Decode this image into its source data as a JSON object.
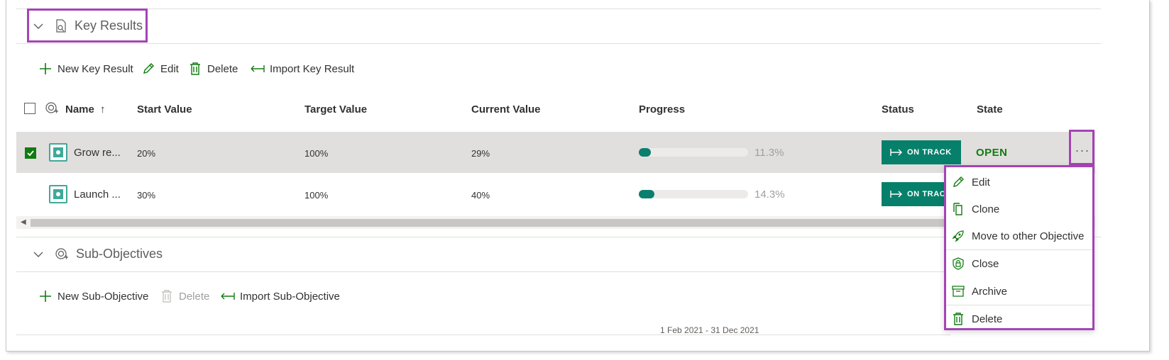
{
  "key_results_section": {
    "title": "Key Results",
    "toolbar": {
      "new_label": "New Key Result",
      "edit_label": "Edit",
      "delete_label": "Delete",
      "import_label": "Import Key Result"
    },
    "columns": {
      "name": "Name",
      "name_sort": "↑",
      "start_value": "Start Value",
      "target_value": "Target Value",
      "current_value": "Current Value",
      "progress": "Progress",
      "status": "Status",
      "state": "State"
    },
    "rows": [
      {
        "selected": true,
        "name": "Grow re...",
        "start_value": "20%",
        "target_value": "100%",
        "current_value": "29%",
        "progress_pct": "11.3%",
        "progress": 0.113,
        "status": "ON TRACK",
        "state": "OPEN"
      },
      {
        "selected": false,
        "name": "Launch ...",
        "start_value": "30%",
        "target_value": "100%",
        "current_value": "40%",
        "progress_pct": "14.3%",
        "progress": 0.143,
        "status": "ON TRACK",
        "state": ""
      }
    ],
    "more_button": "···"
  },
  "sub_objectives_section": {
    "title": "Sub-Objectives",
    "toolbar": {
      "new_label": "New Sub-Objective",
      "delete_label": "Delete",
      "import_label": "Import Sub-Objective"
    }
  },
  "context_menu": {
    "items": [
      {
        "label": "Edit",
        "icon": "pencil-icon"
      },
      {
        "label": "Clone",
        "icon": "copy-icon"
      },
      {
        "label": "Move to other Objective",
        "icon": "rocket-icon"
      },
      {
        "label": "Close",
        "icon": "shield-lock-icon"
      },
      {
        "label": "Archive",
        "icon": "archive-icon"
      },
      {
        "label": "Delete",
        "icon": "trash-icon"
      }
    ]
  },
  "footer": {
    "date_range": "1 Feb 2021 - 31 Dec 2021"
  },
  "colors": {
    "accent_green": "#107c10",
    "status_teal": "#07806b",
    "highlight_purple": "#a543b6"
  }
}
